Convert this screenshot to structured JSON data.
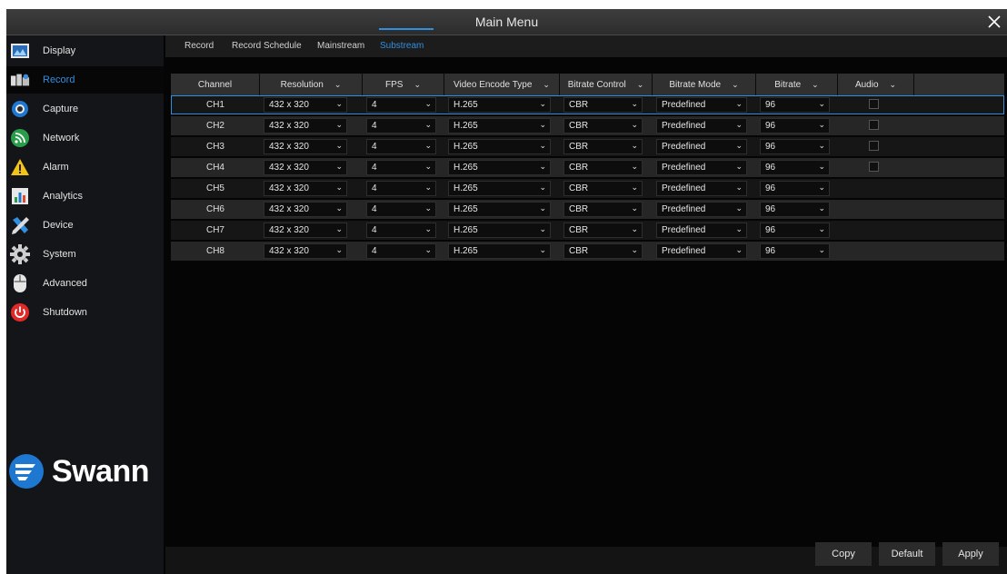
{
  "window": {
    "title": "Main Menu"
  },
  "sidebar": {
    "items": [
      {
        "label": "Display",
        "icon": "display-icon"
      },
      {
        "label": "Record",
        "icon": "record-icon"
      },
      {
        "label": "Capture",
        "icon": "camera-icon"
      },
      {
        "label": "Network",
        "icon": "network-icon"
      },
      {
        "label": "Alarm",
        "icon": "alarm-icon"
      },
      {
        "label": "Analytics",
        "icon": "analytics-icon"
      },
      {
        "label": "Device",
        "icon": "device-icon"
      },
      {
        "label": "System",
        "icon": "gear-icon"
      },
      {
        "label": "Advanced",
        "icon": "mouse-icon"
      },
      {
        "label": "Shutdown",
        "icon": "power-icon"
      }
    ],
    "active": "Record",
    "logo_text": "Swann"
  },
  "tabs": [
    "Record",
    "Record Schedule",
    "Mainstream",
    "Substream"
  ],
  "active_tab": "Substream",
  "columns": [
    "Channel",
    "Resolution",
    "FPS",
    "Video Encode Type",
    "Bitrate Control",
    "Bitrate Mode",
    "Bitrate",
    "Audio"
  ],
  "rows": [
    {
      "channel": "CH1",
      "resolution": "432 x 320",
      "fps": "4",
      "encode": "H.265",
      "control": "CBR",
      "mode": "Predefined",
      "bitrate": "96",
      "audio": true
    },
    {
      "channel": "CH2",
      "resolution": "432 x 320",
      "fps": "4",
      "encode": "H.265",
      "control": "CBR",
      "mode": "Predefined",
      "bitrate": "96",
      "audio": true
    },
    {
      "channel": "CH3",
      "resolution": "432 x 320",
      "fps": "4",
      "encode": "H.265",
      "control": "CBR",
      "mode": "Predefined",
      "bitrate": "96",
      "audio": true
    },
    {
      "channel": "CH4",
      "resolution": "432 x 320",
      "fps": "4",
      "encode": "H.265",
      "control": "CBR",
      "mode": "Predefined",
      "bitrate": "96",
      "audio": true
    },
    {
      "channel": "CH5",
      "resolution": "432 x 320",
      "fps": "4",
      "encode": "H.265",
      "control": "CBR",
      "mode": "Predefined",
      "bitrate": "96",
      "audio": false
    },
    {
      "channel": "CH6",
      "resolution": "432 x 320",
      "fps": "4",
      "encode": "H.265",
      "control": "CBR",
      "mode": "Predefined",
      "bitrate": "96",
      "audio": false
    },
    {
      "channel": "CH7",
      "resolution": "432 x 320",
      "fps": "4",
      "encode": "H.265",
      "control": "CBR",
      "mode": "Predefined",
      "bitrate": "96",
      "audio": false
    },
    {
      "channel": "CH8",
      "resolution": "432 x 320",
      "fps": "4",
      "encode": "H.265",
      "control": "CBR",
      "mode": "Predefined",
      "bitrate": "96",
      "audio": false
    }
  ],
  "buttons": {
    "copy": "Copy",
    "default": "Default",
    "apply": "Apply"
  },
  "colors": {
    "accent": "#2f8fe0",
    "background": "#050505"
  }
}
